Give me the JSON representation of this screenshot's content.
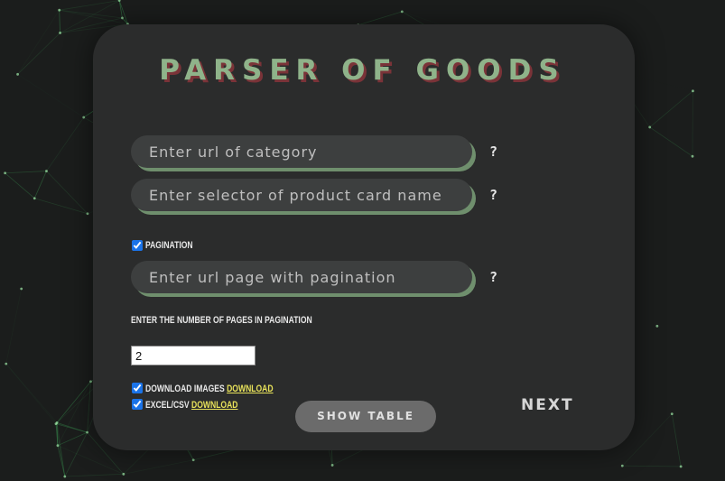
{
  "app": {
    "title": "PARSER OF GOODS",
    "accent_color": "#8fb38a",
    "title_shadow_color": "#7a3338",
    "link_color": "#e7e15a"
  },
  "form": {
    "category_url": {
      "placeholder": "Enter url of category",
      "value": "",
      "help": "?"
    },
    "card_selector": {
      "placeholder": "Enter selector of product card name",
      "value": "",
      "help": "?"
    },
    "pagination": {
      "label": "Pagination",
      "checked": true
    },
    "pagination_url": {
      "placeholder": "Enter url page with pagination",
      "value": "",
      "help": "?"
    },
    "pages_label": "Enter the number of pages in pagination",
    "pages_count": "2",
    "download_images": {
      "label": "Download images",
      "link": "Download",
      "checked": true
    },
    "excel_csv": {
      "label": "Excel/csv",
      "link": "Download",
      "checked": true
    }
  },
  "buttons": {
    "show_table": "Show table",
    "next": "Next"
  }
}
